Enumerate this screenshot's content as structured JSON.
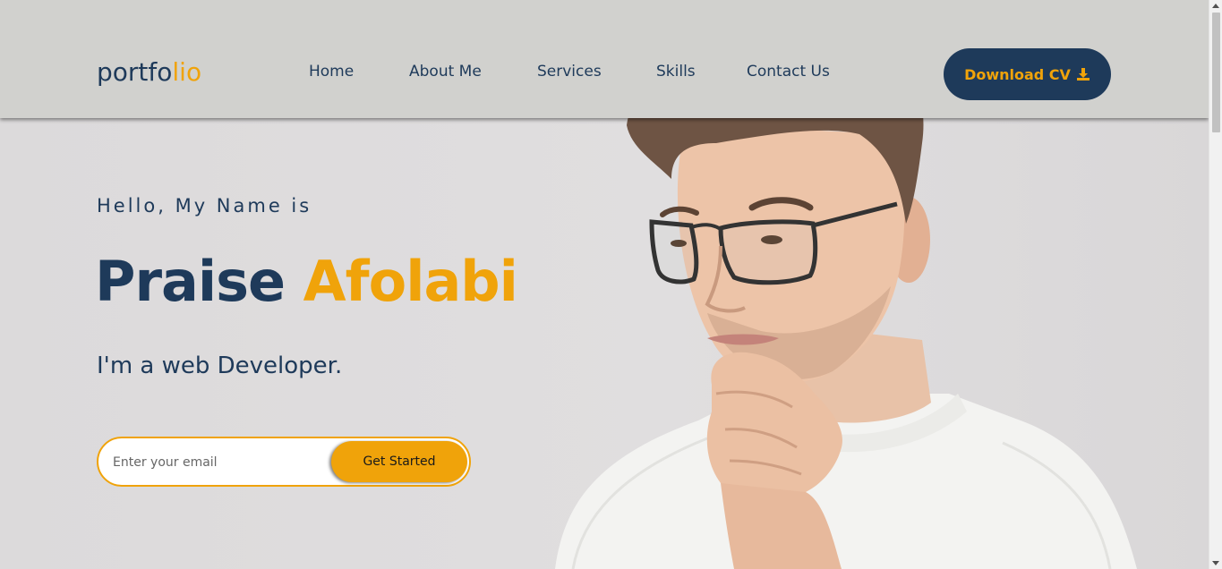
{
  "logo": {
    "part1": "portfo",
    "part2": "lio"
  },
  "nav": [
    {
      "label": "Home"
    },
    {
      "label": "About Me"
    },
    {
      "label": "Services"
    },
    {
      "label": "Skills"
    },
    {
      "label": "Contact Us"
    }
  ],
  "header": {
    "download_label": "Download CV",
    "download_icon": "download-icon"
  },
  "hero": {
    "greeting": "Hello, My Name is",
    "first_name": "Praise",
    "last_name": "Afolabi",
    "role": "I'm a web Developer.",
    "email_placeholder": "Enter your email",
    "cta_label": "Get Started"
  },
  "colors": {
    "navy": "#1e3a5a",
    "accent": "#f0a30a",
    "header_bg": "#d1d1ce",
    "page_bg": "#dcdadb"
  }
}
